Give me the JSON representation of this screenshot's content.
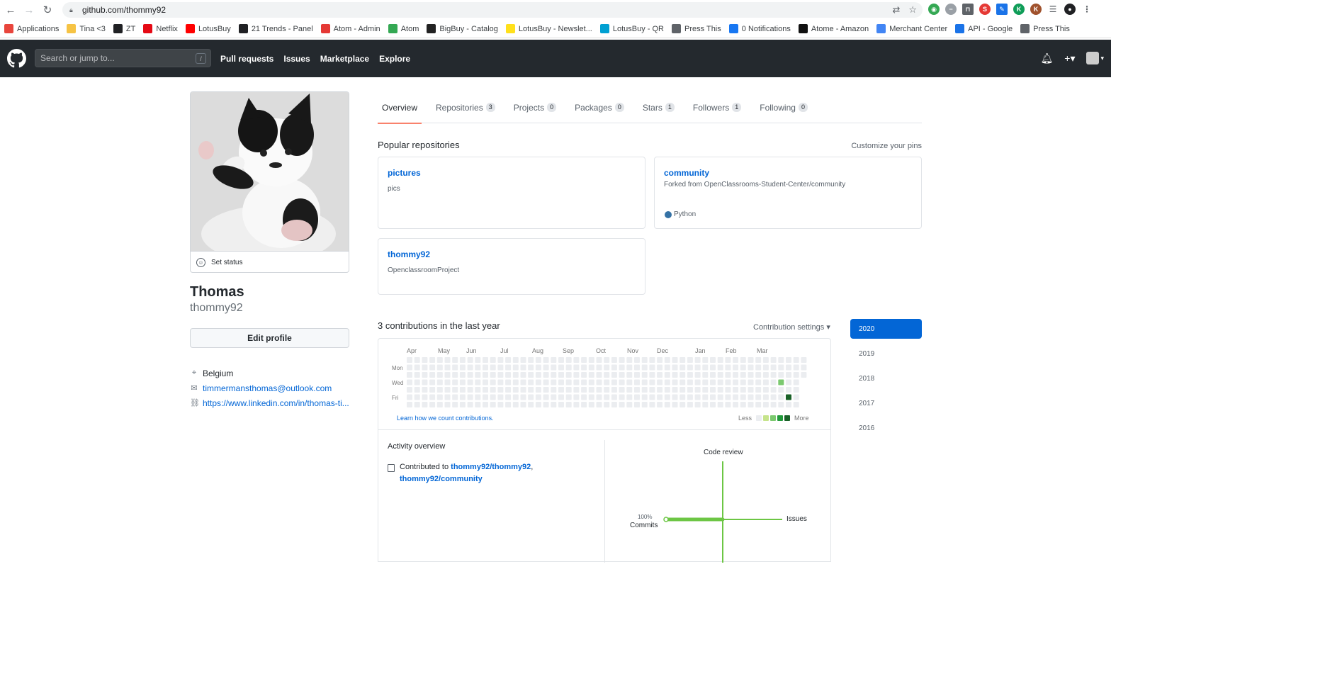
{
  "browser": {
    "url": "github.com/thommy92",
    "bookmarks": [
      {
        "label": "Applications",
        "icon": "apps-grid-icon",
        "color": "#e8453c"
      },
      {
        "label": "Tina <3",
        "icon": "folder-icon",
        "color": "#f6c344"
      },
      {
        "label": "ZT",
        "icon": "zt-icon",
        "color": "#202124"
      },
      {
        "label": "Netflix",
        "icon": "netflix-icon",
        "color": "#e50914"
      },
      {
        "label": "LotusBuy",
        "icon": "youtube-icon",
        "color": "#ff0000"
      },
      {
        "label": "21 Trends - Panel",
        "icon": "circle-icon",
        "color": "#202124"
      },
      {
        "label": "Atom - Admin",
        "icon": "b-icon",
        "color": "#e53935"
      },
      {
        "label": "Atom",
        "icon": "shopify-icon",
        "color": "#34a853"
      },
      {
        "label": "BigBuy - Catalog",
        "icon": "bigbuy-icon",
        "color": "#222"
      },
      {
        "label": "LotusBuy - Newslet...",
        "icon": "mailchimp-icon",
        "color": "#ffe01b"
      },
      {
        "label": "LotusBuy - QR",
        "icon": "qr-icon",
        "color": "#00a0d2"
      },
      {
        "label": "Press This",
        "icon": "globe-icon",
        "color": "#5f6368"
      },
      {
        "label": "0 Notifications",
        "icon": "facebook-icon",
        "color": "#1877f2"
      },
      {
        "label": "Atome - Amazon",
        "icon": "amazon-icon",
        "color": "#111"
      },
      {
        "label": "Merchant Center",
        "icon": "merchant-icon",
        "color": "#4285f4"
      },
      {
        "label": "API - Google",
        "icon": "api-icon",
        "color": "#1a73e8"
      },
      {
        "label": "Press This",
        "icon": "globe-icon",
        "color": "#5f6368"
      }
    ]
  },
  "header": {
    "search_placeholder": "Search or jump to...",
    "slash_key": "/",
    "nav": [
      "Pull requests",
      "Issues",
      "Marketplace",
      "Explore"
    ]
  },
  "profile": {
    "set_status": "Set status",
    "full_name": "Thomas",
    "username": "thommy92",
    "edit_profile": "Edit profile",
    "location": "Belgium",
    "email": "timmermansthomas@outlook.com",
    "website": "https://www.linkedin.com/in/thomas-ti..."
  },
  "tabs": [
    {
      "label": "Overview",
      "count": null
    },
    {
      "label": "Repositories",
      "count": "3"
    },
    {
      "label": "Projects",
      "count": "0"
    },
    {
      "label": "Packages",
      "count": "0"
    },
    {
      "label": "Stars",
      "count": "1"
    },
    {
      "label": "Followers",
      "count": "1"
    },
    {
      "label": "Following",
      "count": "0"
    }
  ],
  "popular": {
    "title": "Popular repositories",
    "customize": "Customize your pins",
    "repos": [
      {
        "name": "pictures",
        "desc": "pics"
      },
      {
        "name": "community",
        "forked": "Forked from OpenClassrooms-Student-Center/community",
        "language": "Python",
        "language_color": "#3572A5"
      },
      {
        "name": "thommy92",
        "desc": "OpenclassroomProject"
      }
    ]
  },
  "contributions": {
    "title": "3 contributions in the last year",
    "settings": "Contribution settings ▾",
    "months": [
      "Apr",
      "May",
      "Jun",
      "Jul",
      "Aug",
      "Sep",
      "Oct",
      "Nov",
      "Dec",
      "Jan",
      "Feb",
      "Mar"
    ],
    "days": [
      "Mon",
      "Wed",
      "Fri"
    ],
    "learn": "Learn how we count contributions.",
    "less": "Less",
    "more": "More",
    "legend_colors": [
      "#ebedf0",
      "#c6e48b",
      "#7bc96f",
      "#239a3b",
      "#196127"
    ],
    "active_cells": [
      {
        "week": 49,
        "day": 3,
        "level": 2
      },
      {
        "week": 50,
        "day": 5,
        "level": 4
      }
    ]
  },
  "years": [
    "2020",
    "2019",
    "2018",
    "2017",
    "2016"
  ],
  "activity": {
    "title": "Activity overview",
    "contributed_prefix": "Contributed to",
    "repo1": "thommy92/thommy92",
    "repo2": "thommy92/community",
    "code_review": "Code review",
    "issues": "Issues",
    "commits": "Commits",
    "commits_pct": "100%"
  }
}
